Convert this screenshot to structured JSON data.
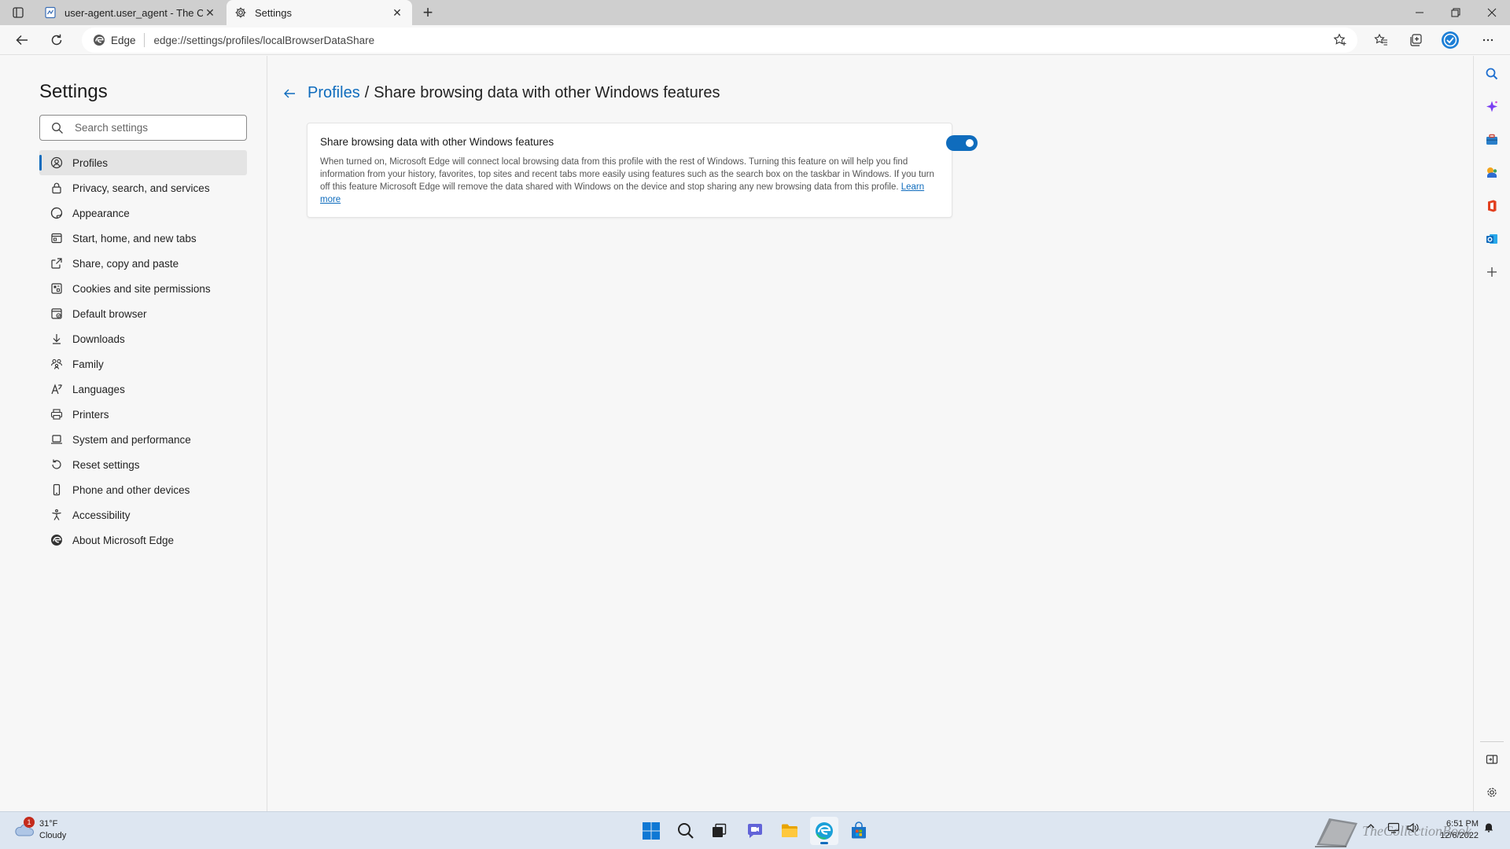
{
  "tabs": [
    {
      "title": "user-agent.user_agent - The Coll",
      "active": false
    },
    {
      "title": "Settings",
      "active": true
    }
  ],
  "toolbar": {
    "site_label": "Edge",
    "url": "edge://settings/profiles/localBrowserDataShare"
  },
  "sidebar": {
    "title": "Settings",
    "search_placeholder": "Search settings",
    "items": [
      {
        "label": "Profiles",
        "icon": "profile-icon",
        "selected": true
      },
      {
        "label": "Privacy, search, and services",
        "icon": "lock-icon"
      },
      {
        "label": "Appearance",
        "icon": "appearance-icon"
      },
      {
        "label": "Start, home, and new tabs",
        "icon": "home-tabs-icon"
      },
      {
        "label": "Share, copy and paste",
        "icon": "share-icon"
      },
      {
        "label": "Cookies and site permissions",
        "icon": "cookies-icon"
      },
      {
        "label": "Default browser",
        "icon": "default-browser-icon"
      },
      {
        "label": "Downloads",
        "icon": "download-icon"
      },
      {
        "label": "Family",
        "icon": "family-icon"
      },
      {
        "label": "Languages",
        "icon": "languages-icon"
      },
      {
        "label": "Printers",
        "icon": "printer-icon"
      },
      {
        "label": "System and performance",
        "icon": "laptop-icon"
      },
      {
        "label": "Reset settings",
        "icon": "reset-icon"
      },
      {
        "label": "Phone and other devices",
        "icon": "phone-icon"
      },
      {
        "label": "Accessibility",
        "icon": "accessibility-icon"
      },
      {
        "label": "About Microsoft Edge",
        "icon": "edge-logo-icon"
      }
    ]
  },
  "main": {
    "breadcrumb_link": "Profiles",
    "breadcrumb_sep": "/",
    "breadcrumb_current": "Share browsing data with other Windows features",
    "card": {
      "title": "Share browsing data with other Windows features",
      "description": "When turned on, Microsoft Edge will connect local browsing data from this profile with the rest of Windows. Turning this feature on will help you find information from your history, favorites, top sites and recent tabs more easily using features such as the search box on the taskbar in Windows. If you turn off this feature Microsoft Edge will remove the data shared with Windows on the device and stop sharing any new browsing data from this profile.",
      "learn_more": "Learn more",
      "toggle_on": true
    }
  },
  "taskbar": {
    "weather_temp": "31°F",
    "weather_cond": "Cloudy",
    "weather_badge": "1",
    "time": "6:51 PM",
    "date": "12/6/2022",
    "watermark_text": "TheCollectionBook"
  },
  "colors": {
    "accent": "#0f6cbd",
    "tabstrip": "#cfcfcf",
    "taskbar": "#dde6f1"
  }
}
